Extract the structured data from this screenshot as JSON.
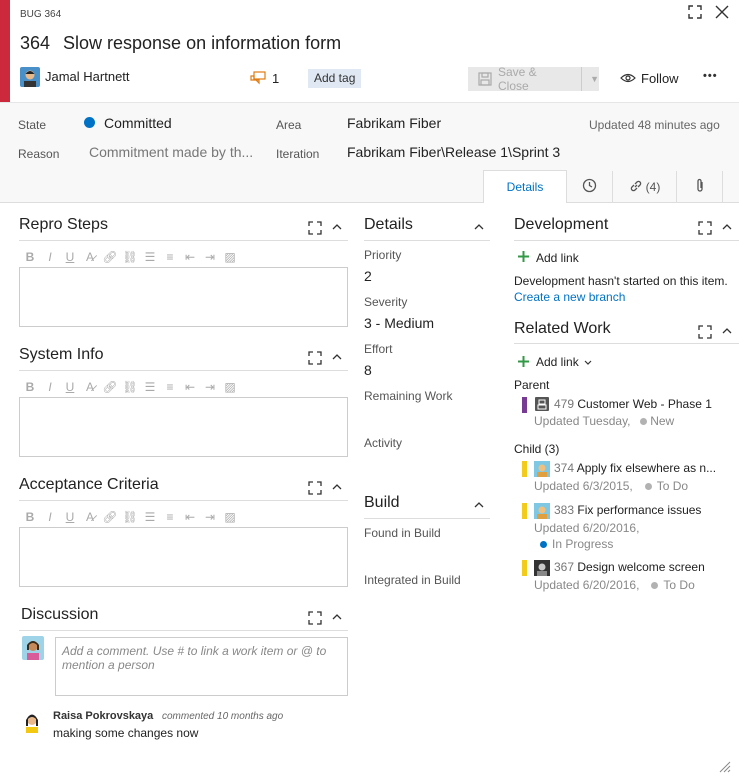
{
  "header": {
    "type_label": "BUG 364",
    "id": "364",
    "title": "Slow response on information form",
    "assignee": "Jamal Hartnett",
    "discussion_count": "1",
    "add_tag": "Add tag",
    "save_close": "Save & Close",
    "follow": "Follow",
    "more": "•••"
  },
  "fields": {
    "state_label": "State",
    "state_value": "Committed",
    "state_color": "#0072c6",
    "reason_label": "Reason",
    "reason_value": "Commitment made by th...",
    "area_label": "Area",
    "area_value": "Fabrikam Fiber",
    "iteration_label": "Iteration",
    "iteration_value": "Fabrikam Fiber\\Release 1\\Sprint 3",
    "updated": "Updated 48 minutes ago"
  },
  "tabs": {
    "details": "Details",
    "links_count": "(4)"
  },
  "left": {
    "repro_title": "Repro Steps",
    "sysinfo_title": "System Info",
    "acceptance_title": "Acceptance Criteria",
    "discussion_title": "Discussion",
    "comment_placeholder": "Add a comment. Use # to link a work item or @ to mention a person",
    "comment_author": "Raisa Pokrovskaya",
    "comment_meta": "commented 10 months ago",
    "comment_text": "making some changes now"
  },
  "details": {
    "title": "Details",
    "priority_label": "Priority",
    "priority_value": "2",
    "severity_label": "Severity",
    "severity_value": "3 - Medium",
    "effort_label": "Effort",
    "effort_value": "8",
    "remaining_label": "Remaining Work",
    "activity_label": "Activity",
    "build_title": "Build",
    "found_label": "Found in Build",
    "integrated_label": "Integrated in Build"
  },
  "development": {
    "title": "Development",
    "add_link": "Add link",
    "message": "Development hasn't started on this item.",
    "create_branch": "Create a new branch"
  },
  "related": {
    "title": "Related Work",
    "add_link": "Add link",
    "parent_label": "Parent",
    "parent": {
      "id": "479",
      "title": "Customer Web - Phase 1",
      "updated": "Updated Tuesday,",
      "state": "New",
      "bar_color": "#773b93",
      "state_color": "#b2b2b2"
    },
    "child_label": "Child (3)",
    "children": [
      {
        "id": "374",
        "title": "Apply fix elsewhere as n...",
        "updated": "Updated 6/3/2015,",
        "state": "To Do",
        "bar_color": "#f2cb1d",
        "state_color": "#b2b2b2"
      },
      {
        "id": "383",
        "title": "Fix performance issues",
        "updated": "Updated 6/20/2016,",
        "state": "In Progress",
        "bar_color": "#f2cb1d",
        "state_color": "#0072c6"
      },
      {
        "id": "367",
        "title": "Design welcome screen",
        "updated": "Updated 6/20/2016,",
        "state": "To Do",
        "bar_color": "#f2cb1d",
        "state_color": "#b2b2b2"
      }
    ]
  }
}
